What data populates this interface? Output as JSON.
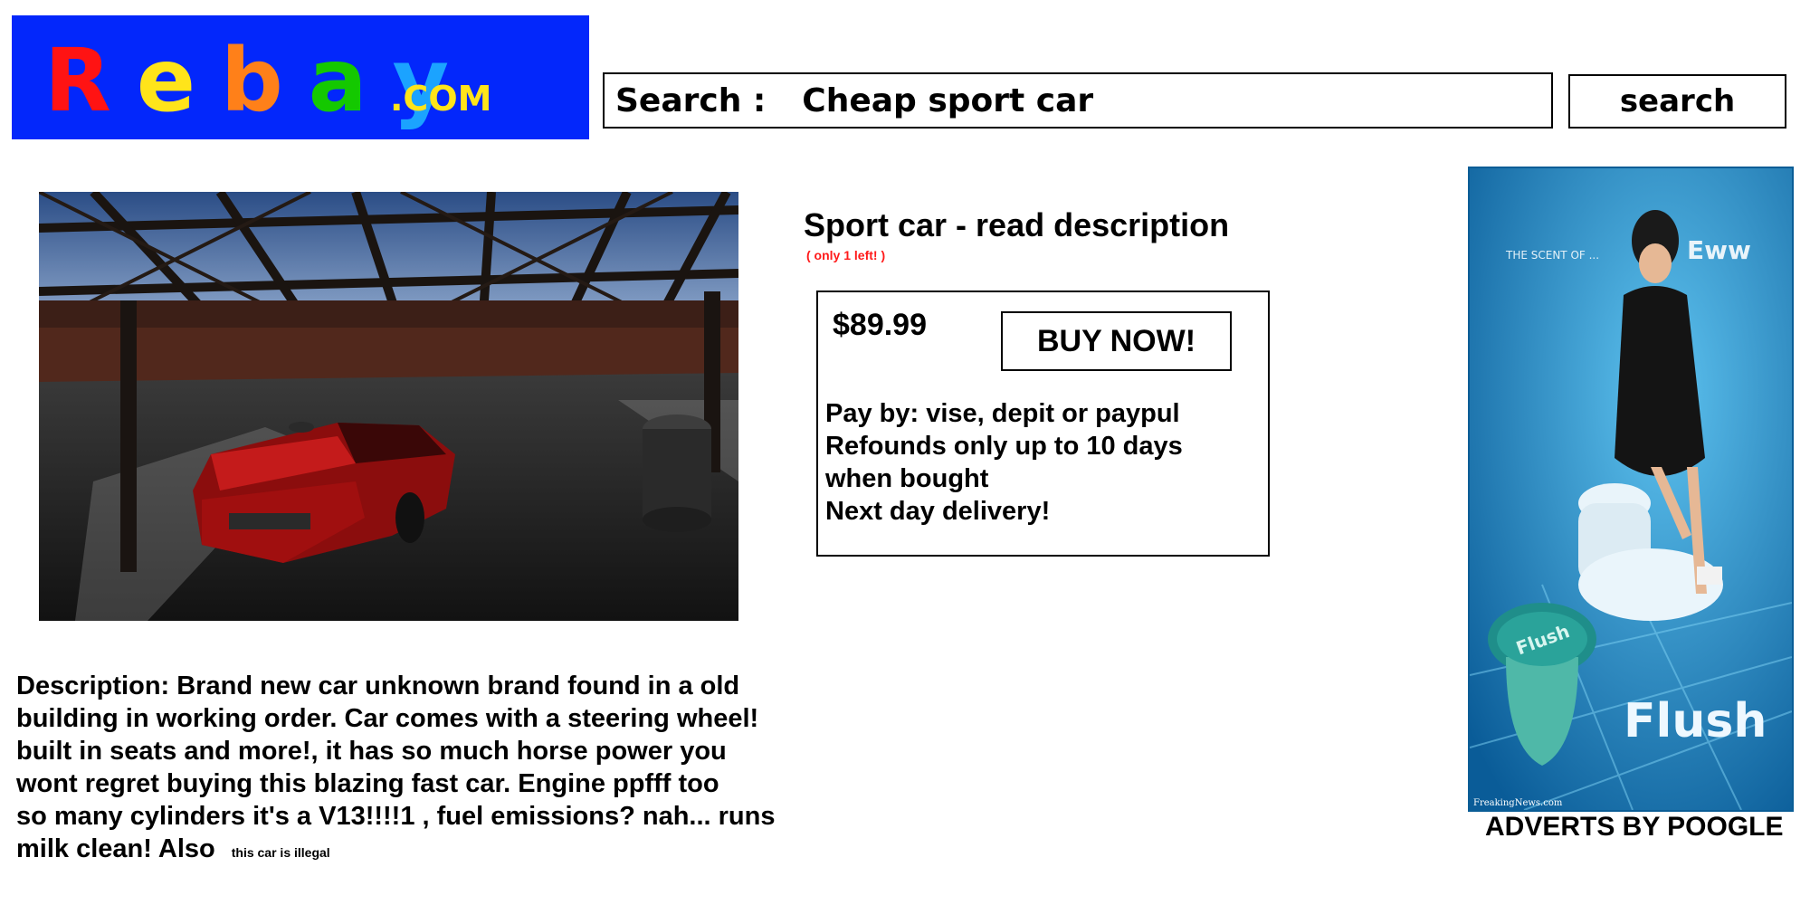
{
  "logo": {
    "letters": [
      {
        "char": "R",
        "color": "#ff1313"
      },
      {
        "char": "e",
        "color": "#ffe41a"
      },
      {
        "char": "b",
        "color": "#ff8019"
      },
      {
        "char": "a",
        "color": "#14c800"
      },
      {
        "char": "y",
        "color": "#1ba3ff"
      }
    ],
    "suffix": ".COM"
  },
  "search": {
    "prefix": "Search :",
    "value": "Cheap sport car",
    "button_label": "search"
  },
  "listing": {
    "title": "Sport car - read description",
    "stock_note": "( only 1 left! )",
    "price": "$89.99",
    "buy_label": "BUY NOW!",
    "info_lines": [
      "Pay by: vise, depit or paypul",
      "Refounds only up to 10 days",
      "when bought",
      "Next day delivery!"
    ],
    "description_lines": [
      "Description: Brand new car unknown brand found in a old",
      "building in working order. Car comes with a steering wheel!",
      "built in seats and more!, it has so much horse power you",
      "wont regret buying this blazing fast car. Engine ppfff too",
      "so many cylinders it's a V13!!!!1 , fuel emissions? nah... runs",
      "milk clean! Also"
    ],
    "fine_print": "this car is illegal"
  },
  "advert": {
    "tagline": "THE SCENT OF ...",
    "reaction": "Eww",
    "brand": "Flush",
    "lid_text": "Flush",
    "credit": "FreakingNews.com",
    "caption": "ADVERTS BY POOGLE"
  },
  "colors": {
    "logo_bg": "#0327fb",
    "stock_note": "#ff1a1a"
  }
}
